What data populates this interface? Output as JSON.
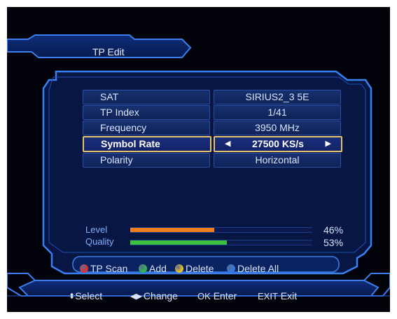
{
  "header": {
    "title": "TP Edit"
  },
  "rows": [
    {
      "label": "SAT",
      "value": "SIRIUS2_3 5E"
    },
    {
      "label": "TP Index",
      "value": "1/41"
    },
    {
      "label": "Frequency",
      "value": "3950 MHz"
    },
    {
      "label": "Symbol Rate",
      "value": "27500 KS/s",
      "selected": true
    },
    {
      "label": "Polarity",
      "value": "Horizontal"
    }
  ],
  "meters": {
    "level": {
      "label": "Level",
      "value": "46%",
      "fraction": 0.46,
      "color": "#f07c1c"
    },
    "quality": {
      "label": "Quality",
      "value": "53%",
      "fraction": 0.53,
      "color": "#3cc23c"
    }
  },
  "legend": [
    {
      "label": "TP Scan",
      "color": "#e23030",
      "icon": "red-button-icon"
    },
    {
      "label": "Add",
      "color": "#2fb84a",
      "icon": "green-button-icon"
    },
    {
      "label": "Delete",
      "color": "#e8c020",
      "icon": "yellow-button-icon"
    },
    {
      "label": "Delete All",
      "color": "#2f7ae0",
      "icon": "blue-button-icon"
    }
  ],
  "hints": [
    {
      "key": "⬍",
      "label": "Select",
      "icon": "up-down-arrows-icon"
    },
    {
      "key": "◀▶",
      "label": "Change",
      "icon": "left-right-arrows-icon"
    },
    {
      "key": "OK",
      "label": "Enter",
      "icon": ""
    },
    {
      "key": "EXIT",
      "label": "Exit",
      "icon": ""
    }
  ],
  "colors": {
    "frame": "#3a7ff0",
    "selected_border": "#e6c36a",
    "background": "#02030a"
  }
}
